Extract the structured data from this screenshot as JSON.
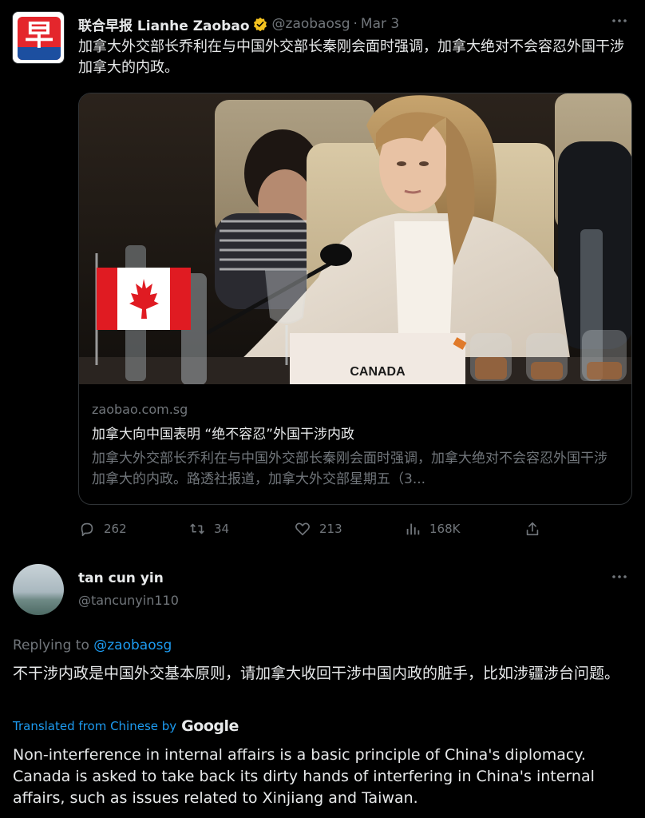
{
  "tweet1": {
    "avatar_glyph": "早",
    "display_name": "联合早报 Lianhe Zaobao",
    "handle": "@zaobaosg",
    "separator": "·",
    "time": "Mar 3",
    "text": "加拿大外交部长乔利在与中国外交部长秦刚会面时强调，加拿大绝对不会容忍外国干涉加拿大的内政。",
    "card": {
      "photo_sign": "CANADA",
      "domain": "zaobao.com.sg",
      "title": "加拿大向中国表明 “绝不容忍”外国干涉内政",
      "description": "加拿大外交部长乔利在与中国外交部长秦刚会面时强调，加拿大绝对不会容忍外国干涉加拿大的内政。路透社报道，加拿大外交部星期五（3..."
    },
    "actions": {
      "replies": "262",
      "retweets": "34",
      "likes": "213",
      "views": "168K"
    }
  },
  "tweet2": {
    "display_name": "tan cun yin",
    "handle": "@tancunyin110",
    "replying_prefix": "Replying to",
    "replying_handle": "@zaobaosg",
    "text_original": "不干涉内政是中国外交基本原则，请加拿大收回干涉中国内政的脏手，比如涉疆涉台问题。",
    "translated_label": "Translated from Chinese by",
    "translator": "Google",
    "text_translated": "Non-interference in internal affairs is a basic principle of China's diplomacy. Canada is asked to take back its dirty hands of interfering in China's internal affairs, such as issues related to Xinjiang and Taiwan."
  },
  "colors": {
    "background": "#000000",
    "text_primary": "#e7e9ea",
    "text_secondary": "#71767b",
    "accent": "#1d9bf0",
    "border": "#2f3336",
    "verified": "#f4c21f"
  },
  "icons": [
    "reply-icon",
    "retweet-icon",
    "like-icon",
    "views-icon",
    "share-icon",
    "more-icon",
    "verified-badge-icon"
  ]
}
